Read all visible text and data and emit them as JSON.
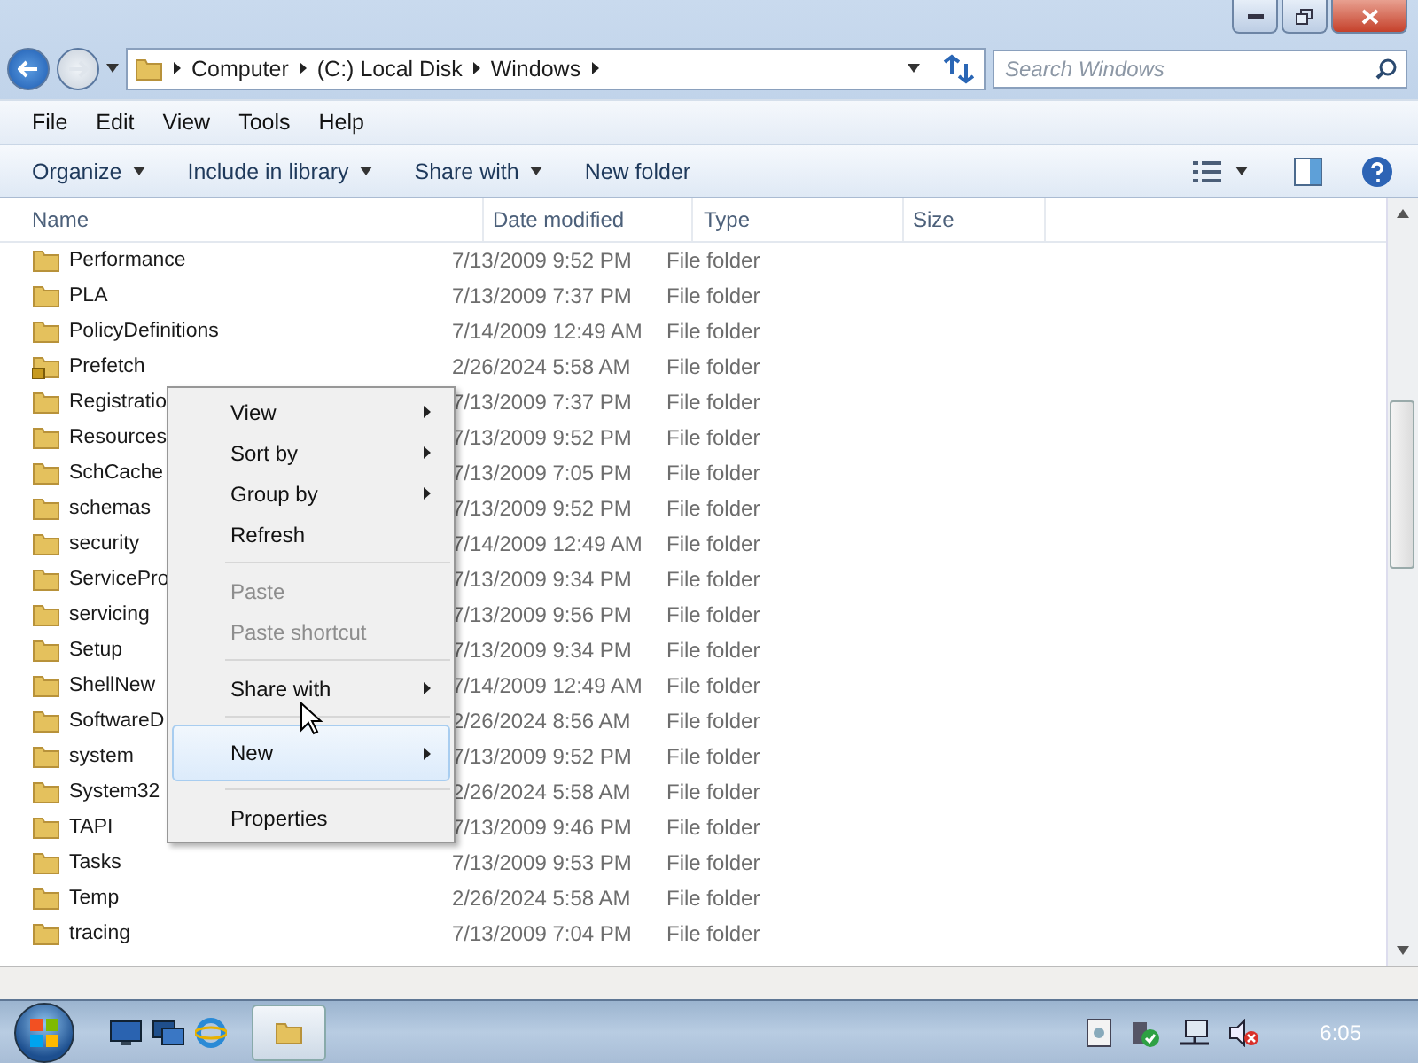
{
  "address": {
    "crumbs": [
      "Computer",
      "(C:) Local Disk",
      "Windows"
    ]
  },
  "search": {
    "placeholder": "Search Windows"
  },
  "menu_bar": [
    "File",
    "Edit",
    "View",
    "Tools",
    "Help"
  ],
  "command_bar": [
    {
      "label": "Organize",
      "dropdown": true
    },
    {
      "label": "Include in library",
      "dropdown": true
    },
    {
      "label": "Share with",
      "dropdown": true
    },
    {
      "label": "New folder",
      "dropdown": false
    }
  ],
  "columns": [
    "Name",
    "Date modified",
    "Type",
    "Size"
  ],
  "rows": [
    {
      "name": "Performance",
      "date": "7/13/2009 9:52 PM",
      "type": "File folder",
      "locked": false
    },
    {
      "name": "PLA",
      "date": "7/13/2009 7:37 PM",
      "type": "File folder",
      "locked": false
    },
    {
      "name": "PolicyDefinitions",
      "date": "7/14/2009 12:49 AM",
      "type": "File folder",
      "locked": false
    },
    {
      "name": "Prefetch",
      "date": "2/26/2024 5:58 AM",
      "type": "File folder",
      "locked": true
    },
    {
      "name": "Registratio",
      "date": "7/13/2009 7:37 PM",
      "type": "File folder",
      "locked": false
    },
    {
      "name": "Resources",
      "date": "7/13/2009 9:52 PM",
      "type": "File folder",
      "locked": false
    },
    {
      "name": "SchCache",
      "date": "7/13/2009 7:05 PM",
      "type": "File folder",
      "locked": false
    },
    {
      "name": "schemas",
      "date": "7/13/2009 9:52 PM",
      "type": "File folder",
      "locked": false
    },
    {
      "name": "security",
      "date": "7/14/2009 12:49 AM",
      "type": "File folder",
      "locked": false
    },
    {
      "name": "ServicePro",
      "date": "7/13/2009 9:34 PM",
      "type": "File folder",
      "locked": false
    },
    {
      "name": "servicing",
      "date": "7/13/2009 9:56 PM",
      "type": "File folder",
      "locked": false
    },
    {
      "name": "Setup",
      "date": "7/13/2009 9:34 PM",
      "type": "File folder",
      "locked": false
    },
    {
      "name": "ShellNew",
      "date": "7/14/2009 12:49 AM",
      "type": "File folder",
      "locked": false
    },
    {
      "name": "SoftwareD",
      "date": "2/26/2024 8:56 AM",
      "type": "File folder",
      "locked": false
    },
    {
      "name": "system",
      "date": "7/13/2009 9:52 PM",
      "type": "File folder",
      "locked": false
    },
    {
      "name": "System32",
      "date": "2/26/2024 5:58 AM",
      "type": "File folder",
      "locked": false
    },
    {
      "name": "TAPI",
      "date": "7/13/2009 9:46 PM",
      "type": "File folder",
      "locked": false
    },
    {
      "name": "Tasks",
      "date": "7/13/2009 9:53 PM",
      "type": "File folder",
      "locked": false
    },
    {
      "name": "Temp",
      "date": "2/26/2024 5:58 AM",
      "type": "File folder",
      "locked": false
    },
    {
      "name": "tracing",
      "date": "7/13/2009 7:04 PM",
      "type": "File folder",
      "locked": false
    }
  ],
  "context_menu": [
    {
      "kind": "item",
      "label": "View",
      "submenu": true,
      "disabled": false,
      "selected": false
    },
    {
      "kind": "item",
      "label": "Sort by",
      "submenu": true,
      "disabled": false,
      "selected": false
    },
    {
      "kind": "item",
      "label": "Group by",
      "submenu": true,
      "disabled": false,
      "selected": false
    },
    {
      "kind": "item",
      "label": "Refresh",
      "submenu": false,
      "disabled": false,
      "selected": false
    },
    {
      "kind": "separator"
    },
    {
      "kind": "item",
      "label": "Paste",
      "submenu": false,
      "disabled": true,
      "selected": false
    },
    {
      "kind": "item",
      "label": "Paste shortcut",
      "submenu": false,
      "disabled": true,
      "selected": false
    },
    {
      "kind": "separator"
    },
    {
      "kind": "item",
      "label": "Share with",
      "submenu": true,
      "disabled": false,
      "selected": false
    },
    {
      "kind": "separator"
    },
    {
      "kind": "item",
      "label": "New",
      "submenu": true,
      "disabled": false,
      "selected": true
    },
    {
      "kind": "separator"
    },
    {
      "kind": "item",
      "label": "Properties",
      "submenu": false,
      "disabled": false,
      "selected": false
    }
  ],
  "taskbar": {
    "clock": "6:05"
  }
}
